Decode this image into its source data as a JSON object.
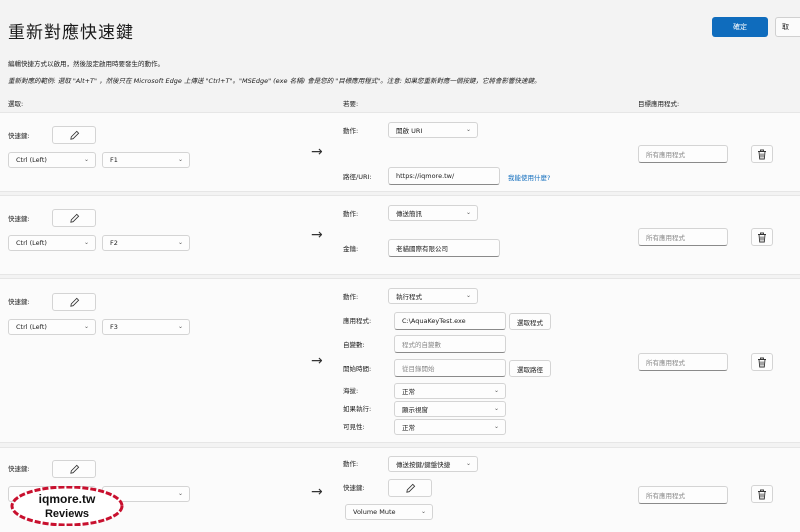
{
  "window": {
    "title": "重新對應快速鍵",
    "ok_label": "確定",
    "cancel_label": "取"
  },
  "description": {
    "line1": "編輯快捷方式以啟用，然後設定啟用時要發生的動作。",
    "line2": "重新對應的範例: 選取 \"Alt+T\" ，然後只在 Microsoft Edge 上傳送 \"Ctrl+T\"。\"MSEdge\" (exe 名稱) 會是您的 \"目標應用程式\"。注意: 如果您重新對應一個按鍵，它將會影響快速鍵。"
  },
  "columns": {
    "select": "選取:",
    "to": "若要:",
    "target_app": "目標應用程式:"
  },
  "rows": [
    {
      "shortcut_label": "快速鍵:",
      "modifier": "Ctrl (Left)",
      "key": "F1",
      "action_label": "動作:",
      "action": "開啟 URI",
      "path_label": "路徑/URI:",
      "path_value": "https://iqmore.tw/",
      "help_link": "我能使用什麼?",
      "target_placeholder": "所有應用程式"
    },
    {
      "shortcut_label": "快速鍵:",
      "modifier": "Ctrl (Left)",
      "key": "F2",
      "action_label": "動作:",
      "action": "傳送簡訊",
      "text_label": "金鑰:",
      "text_value": "老貓國際有限公司",
      "target_placeholder": "所有應用程式"
    },
    {
      "shortcut_label": "快速鍵:",
      "modifier": "Ctrl (Left)",
      "key": "F3",
      "action_label": "動作:",
      "action": "執行程式",
      "app_label": "應用程式:",
      "app_value": "C:\\AquaKeyTest.exe",
      "select_program": "選取程式",
      "args_label": "自變數:",
      "args_placeholder": "程式的自變數",
      "start_label": "開始時間:",
      "start_placeholder": "從目錄開始",
      "select_path": "選取路徑",
      "elevation_label": "海拔:",
      "elevation_value": "正常",
      "if_running_label": "如果執行:",
      "if_running_value": "顯示視窗",
      "visibility_label": "可見性:",
      "visibility_value": "正常",
      "target_placeholder": "所有應用程式"
    },
    {
      "shortcut_label": "快速鍵:",
      "action_label": "動作:",
      "action": "傳送按鍵/鍵盤快捷",
      "send_shortcut_label": "快速鍵:",
      "send_key": "Volume Mute",
      "target_placeholder": "所有應用程式"
    }
  ],
  "watermark": {
    "line1": "iqmore.tw",
    "line2": "Reviews"
  },
  "icons": {
    "edit": "pencil-icon",
    "delete": "trash-icon",
    "arrow": "arrow-right-icon",
    "dropdown": "chevron-down-icon"
  }
}
